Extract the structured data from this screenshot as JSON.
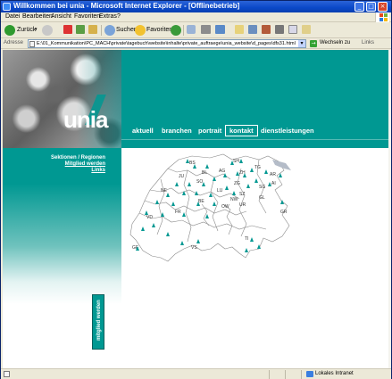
{
  "window": {
    "title": "Willkommen bei unia - Microsoft Internet Explorer - [Offlinebetrieb]",
    "controls": {
      "minimize": "_",
      "maximize": "□",
      "close": "×"
    }
  },
  "menu": [
    "Datei",
    "Bearbeiten",
    "Ansicht",
    "Favoriten",
    "Extras",
    "?"
  ],
  "toolbar": {
    "back_label": "Zurück",
    "search_label": "Suchen",
    "favorites_label": "Favoriten"
  },
  "address": {
    "label": "Adresse",
    "url": "E:\\01_Kommunikation\\PC_MACH\\private\\tagebuch\\website\\inhalte\\private_auftraege\\unia_website\\d_pages\\dfs31.html",
    "go_label": "Wechseln zu",
    "links_label": "Links"
  },
  "site": {
    "logo": "unia",
    "nav": [
      "aktuell",
      "branchen",
      "portrait",
      "kontakt",
      "dienstleistungen"
    ],
    "active_nav": "kontakt",
    "sidebar_links": [
      "Sektionen / Regionen",
      "Mitglied werden",
      "Links"
    ],
    "side_button": "mitglied werden",
    "map_labels": {
      "bs": "BS",
      "sh": "SH",
      "tg": "TG",
      "ar": "AR",
      "ai": "AI",
      "sg": "SG",
      "ag": "AG",
      "zh": "ZH",
      "bl": "BL",
      "so": "SO",
      "ju": "JU",
      "zg": "ZG",
      "sz": "SZ",
      "lu": "LU",
      "nw": "NW",
      "ow": "OW",
      "ur": "UR",
      "gl": "GL",
      "gr": "GR",
      "be": "BE",
      "ne": "NE",
      "fr": "FR",
      "vd": "VD",
      "ge": "GE",
      "vs": "VS",
      "ti": "TI"
    }
  },
  "status": {
    "zone": "Lokales Intranet"
  },
  "colors": {
    "teal": "#009892",
    "titlebar": "#0a48c8"
  }
}
